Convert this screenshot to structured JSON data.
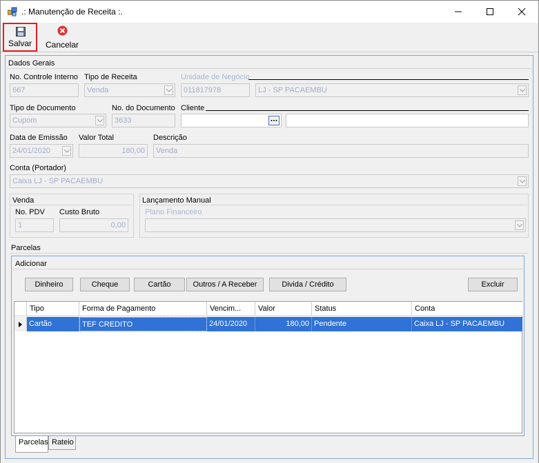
{
  "window": {
    "title": ".: Manutenção de Receita :."
  },
  "toolbar": {
    "save_label": "Salvar",
    "cancel_label": "Cancelar"
  },
  "dados_gerais": {
    "title": "Dados Gerais",
    "controle_label": "No. Controle Interno",
    "controle_value": "667",
    "tipo_receita_label": "Tipo de Receita",
    "tipo_receita_value": "Venda",
    "unidade_label": "Unidade de Negócio",
    "unidade_code": "011817978",
    "unidade_name": "LJ - SP PACAEMBU",
    "tipo_documento_label": "Tipo de Documento",
    "tipo_documento_value": "Cupom",
    "numero_documento_label": "No. do Documento",
    "numero_documento_value": "3633",
    "cliente_label": "Cliente",
    "cliente_code": "",
    "cliente_name": "",
    "data_emissao_label": "Data de Emissão",
    "data_emissao_value": "24/01/2020",
    "valor_total_label": "Valor Total",
    "valor_total_value": "180,00",
    "descricao_label": "Descrição",
    "descricao_value": "Venda",
    "conta_label": "Conta (Portador)",
    "conta_value": "Caixa LJ - SP PACAEMBU"
  },
  "venda": {
    "title": "Venda",
    "pdv_label": "No. PDV",
    "pdv_value": "1",
    "custo_label": "Custo Bruto",
    "custo_value": "0,00"
  },
  "lancamento": {
    "title": "Lançamento Manual",
    "plano_label": "Plano Financeiro",
    "plano_value": ""
  },
  "parcelas": {
    "title": "Parcelas",
    "adicionar_title": "Adicionar",
    "buttons": {
      "dinheiro": "Dinheiro",
      "cheque": "Cheque",
      "cartao": "Cartão",
      "outros": "Outros / A Receber",
      "divida": "Divida / Crédito",
      "excluir": "Excluir"
    },
    "columns": [
      "Tipo",
      "Forma de Pagamento",
      "Vencim...",
      "Valor",
      "Status",
      "Conta"
    ],
    "rows": [
      {
        "tipo": "Cartão",
        "forma": "TEF CREDITO",
        "vencimento": "24/01/2020",
        "valor": "180,00",
        "status": "Pendente",
        "conta": "Caixa LJ - SP PACAEMBU"
      }
    ]
  },
  "tabs": [
    "Parcelas",
    "Rateio"
  ],
  "colors": {
    "accent": "#3072d6",
    "highlight_border": "#e02020",
    "disabled_text": "#a0aec8"
  },
  "icons": {
    "app": "app-window-icon",
    "save": "floppy-disk-icon",
    "cancel": "red-x-circle-icon"
  }
}
